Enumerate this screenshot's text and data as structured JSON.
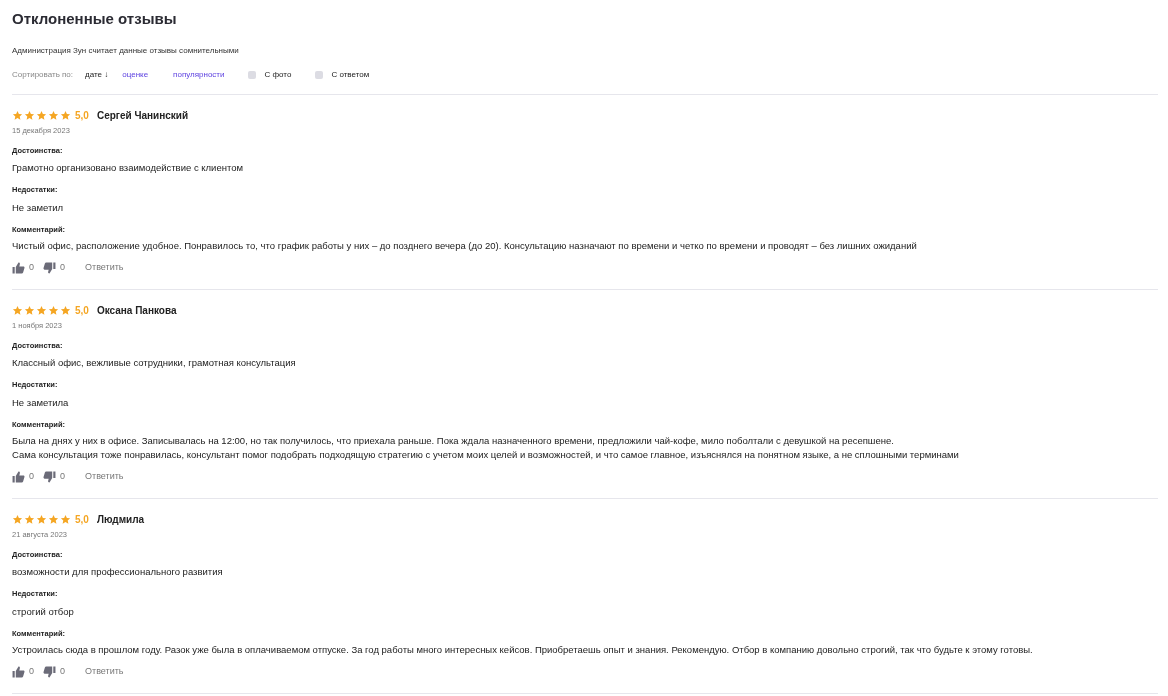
{
  "title": "Отклоненные отзывы",
  "subtitle": "Администрация Зун считает данные отзывы сомнительными",
  "sort": {
    "label": "Сортировать по:",
    "options": [
      {
        "label": "дате",
        "arrow": "↓",
        "selected": true
      },
      {
        "label": "оценке",
        "selected": false
      },
      {
        "label": "популярности",
        "selected": false
      }
    ]
  },
  "filters": [
    {
      "label": "С фото",
      "checked": false
    },
    {
      "label": "С ответом",
      "checked": false
    }
  ],
  "reviews": [
    {
      "stars": 5,
      "rating": "5,0",
      "author": "Сергей Чанинский",
      "date": "15 декабря 2023",
      "pros_label": "Достоинства:",
      "pros": "Грамотно организовано взаимодействие с клиентом",
      "cons_label": "Недостатки:",
      "cons": "Не заметил",
      "comment_label": "Комментарий:",
      "comment": [
        "Чистый офис, расположение удобное. Понравилось то, что график работы у них – до позднего вечера (до 20). Консультацию назначают по времени и четко по времени и проводят – без лишних ожиданий"
      ],
      "likes": "0",
      "dislikes": "0",
      "reply": "Ответить"
    },
    {
      "stars": 5,
      "rating": "5,0",
      "author": "Оксана Панкова",
      "date": "1 ноября 2023",
      "pros_label": "Достоинства:",
      "pros": "Классный офис, вежливые сотрудники, грамотная консультация",
      "cons_label": "Недостатки:",
      "cons": "Не заметила",
      "comment_label": "Комментарий:",
      "comment": [
        "Была на днях у них в офисе. Записывалась на 12:00, но так получилось, что приехала раньше. Пока ждала назначенного времени, предложили чай-кофе, мило поболтали с девушкой на ресепшене.",
        "Сама консультация тоже понравилась, консультант помог подобрать подходящую стратегию с учетом моих целей и возможностей, и что самое главное, изъяснялся на понятном языке, а не сплошными терминами"
      ],
      "likes": "0",
      "dislikes": "0",
      "reply": "Ответить"
    },
    {
      "stars": 5,
      "rating": "5,0",
      "author": "Людмила",
      "date": "21 августа 2023",
      "pros_label": "Достоинства:",
      "pros": "возможности для профессионального развития",
      "cons_label": "Недостатки:",
      "cons": "строгий отбор",
      "comment_label": "Комментарий:",
      "comment": [
        "Устроилась сюда в прошлом году. Разок уже была в оплачиваемом отпуске. За год работы много интересных кейсов. Приобретаешь опыт и знания. Рекомендую. Отбор в компанию довольно строгий, так что будьте к этому готовы."
      ],
      "likes": "0",
      "dislikes": "0",
      "reply": "Ответить"
    }
  ]
}
